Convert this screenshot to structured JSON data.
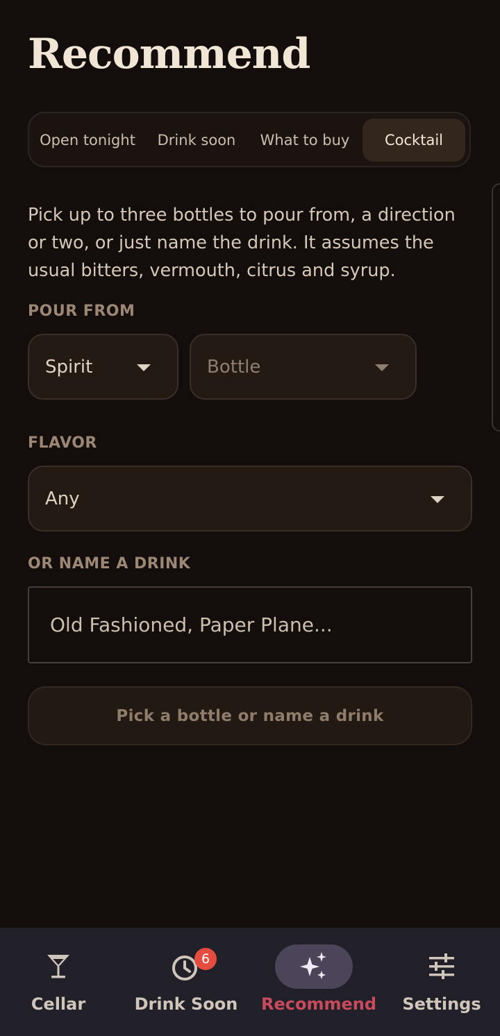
{
  "page": {
    "title": "Recommend"
  },
  "tabs": [
    {
      "label": "Open tonight",
      "active": false
    },
    {
      "label": "Drink soon",
      "active": false
    },
    {
      "label": "What to buy",
      "active": false
    },
    {
      "label": "Cocktail",
      "active": true
    }
  ],
  "intro": "Pick up to three bottles to pour from, a direction or two, or just name the drink. It assumes the usual bitters, vermouth, citrus and syrup.",
  "pour_from": {
    "label": "POUR FROM",
    "spirit_value": "Spirit",
    "bottle_placeholder": "Bottle"
  },
  "flavor": {
    "label": "FLAVOR",
    "value": "Any"
  },
  "name_drink": {
    "label": "OR NAME A DRINK",
    "placeholder": "Old Fashioned, Paper Plane...",
    "value": ""
  },
  "submit": {
    "label": "Pick a bottle or name a drink",
    "enabled": false
  },
  "bottom_nav": {
    "items": [
      {
        "label": "Cellar",
        "icon": "cocktail-glass-icon",
        "active": false
      },
      {
        "label": "Drink Soon",
        "icon": "clock-icon",
        "active": false,
        "badge": "6"
      },
      {
        "label": "Recommend",
        "icon": "sparkles-icon",
        "active": true
      },
      {
        "label": "Settings",
        "icon": "sliders-icon",
        "active": false
      }
    ]
  },
  "colors": {
    "background": "#130d0b",
    "accent": "#c74a5d",
    "badge": "#e44c3f",
    "nav_background": "#211f27",
    "active_pill": "#4c4458"
  }
}
